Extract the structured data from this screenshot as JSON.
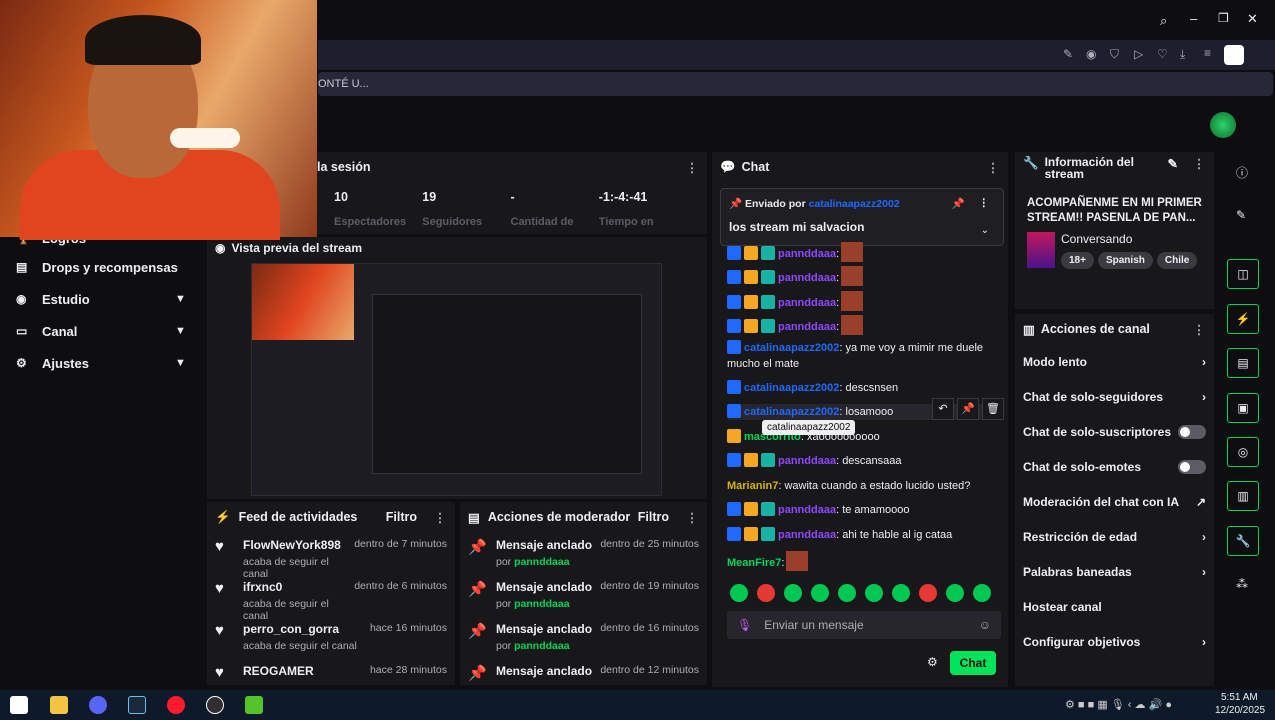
{
  "browser": {
    "url_text": "ONTÉ U..."
  },
  "sidebar": {
    "items": [
      {
        "label": "Logros",
        "icon": "trophy-icon"
      },
      {
        "label": "Drops y recompensas",
        "icon": "gift-icon"
      },
      {
        "label": "Estudio",
        "icon": "studio-icon"
      },
      {
        "label": "Canal",
        "icon": "channel-icon"
      },
      {
        "label": "Ajustes",
        "icon": "gear-icon"
      }
    ]
  },
  "session": {
    "title": "la sesión",
    "stats": [
      {
        "value": "10",
        "label": "Espectadores"
      },
      {
        "value": "19",
        "label": "Seguidores"
      },
      {
        "value": "-",
        "label": "Cantidad de"
      },
      {
        "value": "-1:-4:-41",
        "label": "Tiempo en"
      }
    ]
  },
  "preview": {
    "title": "Vista previa del stream"
  },
  "feed": {
    "title": "Feed de actividades",
    "filter": "Filtro",
    "items": [
      {
        "name": "FlowNewYork898",
        "time": "dentro de 7 minutos",
        "sub": "acaba de seguir el canal"
      },
      {
        "name": "ifrxnc0",
        "time": "dentro de 6 minutos",
        "sub": "acaba de seguir el canal"
      },
      {
        "name": "perro_con_gorra",
        "time": "hace 16 minutos",
        "sub": "acaba de seguir el canal"
      },
      {
        "name": "REOGAMER",
        "time": "hace 28 minutos",
        "sub": ""
      }
    ]
  },
  "mod": {
    "title": "Acciones de moderador",
    "filter": "Filtro",
    "items": [
      {
        "name": "Mensaje anclado",
        "time": "dentro de 25 minutos",
        "by": "por",
        "user": "pannddaaa"
      },
      {
        "name": "Mensaje anclado",
        "time": "dentro de 19 minutos",
        "by": "por",
        "user": "pannddaaa"
      },
      {
        "name": "Mensaje anclado",
        "time": "dentro de 16 minutos",
        "by": "por",
        "user": "pannddaaa"
      },
      {
        "name": "Mensaje anclado",
        "time": "dentro de 12 minutos",
        "by": "",
        "user": ""
      }
    ]
  },
  "chat": {
    "title": "Chat",
    "pinned_prefix": "Enviado por",
    "pinned_user": "catalinaapazz2002",
    "pinned_text": "los stream mi salvacion",
    "messages": [
      {
        "user": "pannddaaa",
        "text": ":",
        "color": "purple"
      },
      {
        "user": "pannddaaa",
        "text": ":",
        "color": "purple"
      },
      {
        "user": "pannddaaa",
        "text": ":",
        "color": "purple"
      },
      {
        "user": "pannddaaa",
        "text": ":",
        "color": "purple"
      },
      {
        "user": "catalinaapazz2002",
        "text": ": ya me voy a mimir me duele mucho el mate",
        "color": "blue"
      },
      {
        "user": "catalinaapazz2002",
        "text": ": descsnsen",
        "color": "blue"
      },
      {
        "user": "catalinaapazz2002",
        "text": ": losamooo",
        "color": "blue"
      },
      {
        "user": "mascorrito",
        "text": ": xaoooooooooo",
        "color": "green"
      },
      {
        "user": "pannddaaa",
        "text": ": descansaaa",
        "color": "purple"
      },
      {
        "user": "Marianin7",
        "text": ": wawita cuando a estado lucido usted?",
        "color": "yellow"
      },
      {
        "user": "pannddaaa",
        "text": ": te amamoooo",
        "color": "purple"
      },
      {
        "user": "pannddaaa",
        "text": ": ahi te hable al ig cataa",
        "color": "purple"
      },
      {
        "user": "MeanFire7",
        "text": ":",
        "color": "green"
      }
    ],
    "tooltip": "catalinaapazz2002",
    "input_placeholder": "Enviar un mensaje",
    "send_label": "Chat"
  },
  "info": {
    "title": "Información del stream",
    "stream_title": "ACOMPAÑENME EN MI PRIMER STREAM!! PASENLA DE PAN...",
    "category": "Conversando",
    "tags": [
      "18+",
      "Spanish",
      "Chile"
    ]
  },
  "actions": {
    "title": "Acciones de canal",
    "items": [
      {
        "label": "Modo lento",
        "control": "chevron"
      },
      {
        "label": "Chat de solo-seguidores",
        "control": "chevron"
      },
      {
        "label": "Chat de solo-suscriptores",
        "control": "toggle"
      },
      {
        "label": "Chat de solo-emotes",
        "control": "toggle"
      },
      {
        "label": "Moderación del chat con IA",
        "control": "external"
      },
      {
        "label": "Restricción de edad",
        "control": "chevron"
      },
      {
        "label": "Palabras baneadas",
        "control": "chevron"
      },
      {
        "label": "Hostear canal",
        "control": "none"
      },
      {
        "label": "Configurar objetivos",
        "control": "chevron"
      }
    ]
  },
  "taskbar": {
    "time": "5:51 AM",
    "date": "12/20/2025"
  },
  "colors": {
    "accent": "#00d65b",
    "purple": "#9147ff",
    "blue": "#1f69ff"
  }
}
